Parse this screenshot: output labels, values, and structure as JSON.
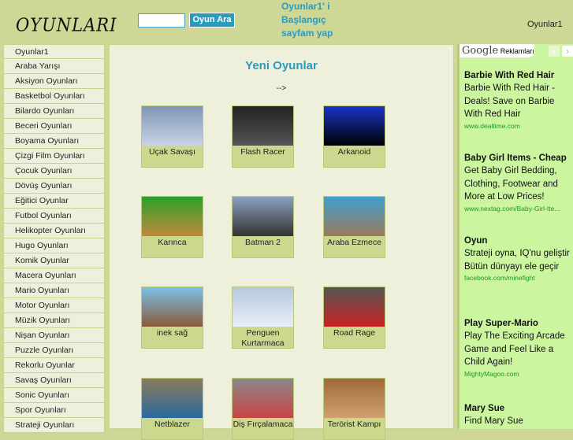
{
  "header": {
    "logo": "OYUNLARI",
    "search_placeholder": "",
    "search_button": "Oyun Ara",
    "homepage_link": "Oyunlar1' i Başlangıç sayfam yap",
    "site_name": "Oyunlar1"
  },
  "sidebar": {
    "items": [
      "Oyunlar1",
      "Araba Yarışı",
      "Aksiyon Oyunları",
      "Basketbol Oyunları",
      "Bilardo Oyunları",
      "Beceri Oyunları",
      "Boyama Oyunları",
      "Çizgi Film Oyunları",
      "Çocuk Oyunları",
      "Dövüş Oyunları",
      "Eğitici Oyunlar",
      "Futbol Oyunları",
      "Helikopter Oyunları",
      "Hugo Oyunları",
      "Komik Oyunlar",
      "Macera Oyunları",
      "Mario Oyunları",
      "Motor Oyunları",
      "Müzik Oyunları",
      "Nişan Oyunları",
      "Puzzle Oyunları",
      "Rekorlu Oyunlar",
      "Savaş Oyunları",
      "Sonic Oyunları",
      "Spor Oyunları",
      "Strateji Oyunları"
    ]
  },
  "main": {
    "title": "Yeni Oyunlar",
    "arrow": "-->",
    "games": [
      {
        "name": "Uçak Savaşı",
        "colors": [
          "#7f95b5",
          "#c9d4e4"
        ]
      },
      {
        "name": "Flash Racer",
        "colors": [
          "#222",
          "#555"
        ]
      },
      {
        "name": "Arkanoid",
        "colors": [
          "#1a33c8",
          "#000"
        ]
      },
      {
        "name": "Karınca",
        "colors": [
          "#2aa02a",
          "#c28a3a"
        ]
      },
      {
        "name": "Batman 2",
        "colors": [
          "#8aa0c0",
          "#333"
        ]
      },
      {
        "name": "Araba Ezmece",
        "colors": [
          "#3fa0d0",
          "#9a7a5a"
        ]
      },
      {
        "name": "inek sağ",
        "colors": [
          "#7ac0e8",
          "#8a5a3a"
        ]
      },
      {
        "name": "Penguen Kurtarmaca",
        "colors": [
          "#b8c8e0",
          "#e8eef8"
        ]
      },
      {
        "name": "Road Rage",
        "colors": [
          "#555",
          "#c22"
        ]
      },
      {
        "name": "Netblazer",
        "colors": [
          "#8a7a5a",
          "#2a6aa0"
        ]
      },
      {
        "name": "Diş Fırçalamaca",
        "colors": [
          "#888",
          "#c44"
        ]
      },
      {
        "name": "Terörist Kampı",
        "colors": [
          "#a06a3a",
          "#d0a070"
        ]
      }
    ]
  },
  "ads": {
    "brand": "Google",
    "label": "Reklamları",
    "prev": "‹",
    "next": "›",
    "items": [
      {
        "title": "Barbie With Red Hair",
        "desc": "Barbie With Red Hair - Deals! Save on Barbie With Red Hair",
        "url": "www.dealtime.com"
      },
      {
        "title": "Baby Girl Items - Cheap",
        "desc": "Get Baby Girl Bedding, Clothing, Footwear and More at Low Prices!",
        "url": "www.nextag.com/Baby-Girl-Ite..."
      },
      {
        "title": "Oyun",
        "desc": "Strateji oyna, IQ'nu geliştir Bütün dünyayı ele geçir",
        "url": "facebook.com/minefight"
      },
      {
        "title": "Play Super-Mario",
        "desc": "Play The Exciting Arcade Game and Feel Like a Child Again!",
        "url": "MightyMagoo.com"
      },
      {
        "title": "Mary Sue",
        "desc": "Find Mary Sue",
        "url": ""
      }
    ]
  }
}
